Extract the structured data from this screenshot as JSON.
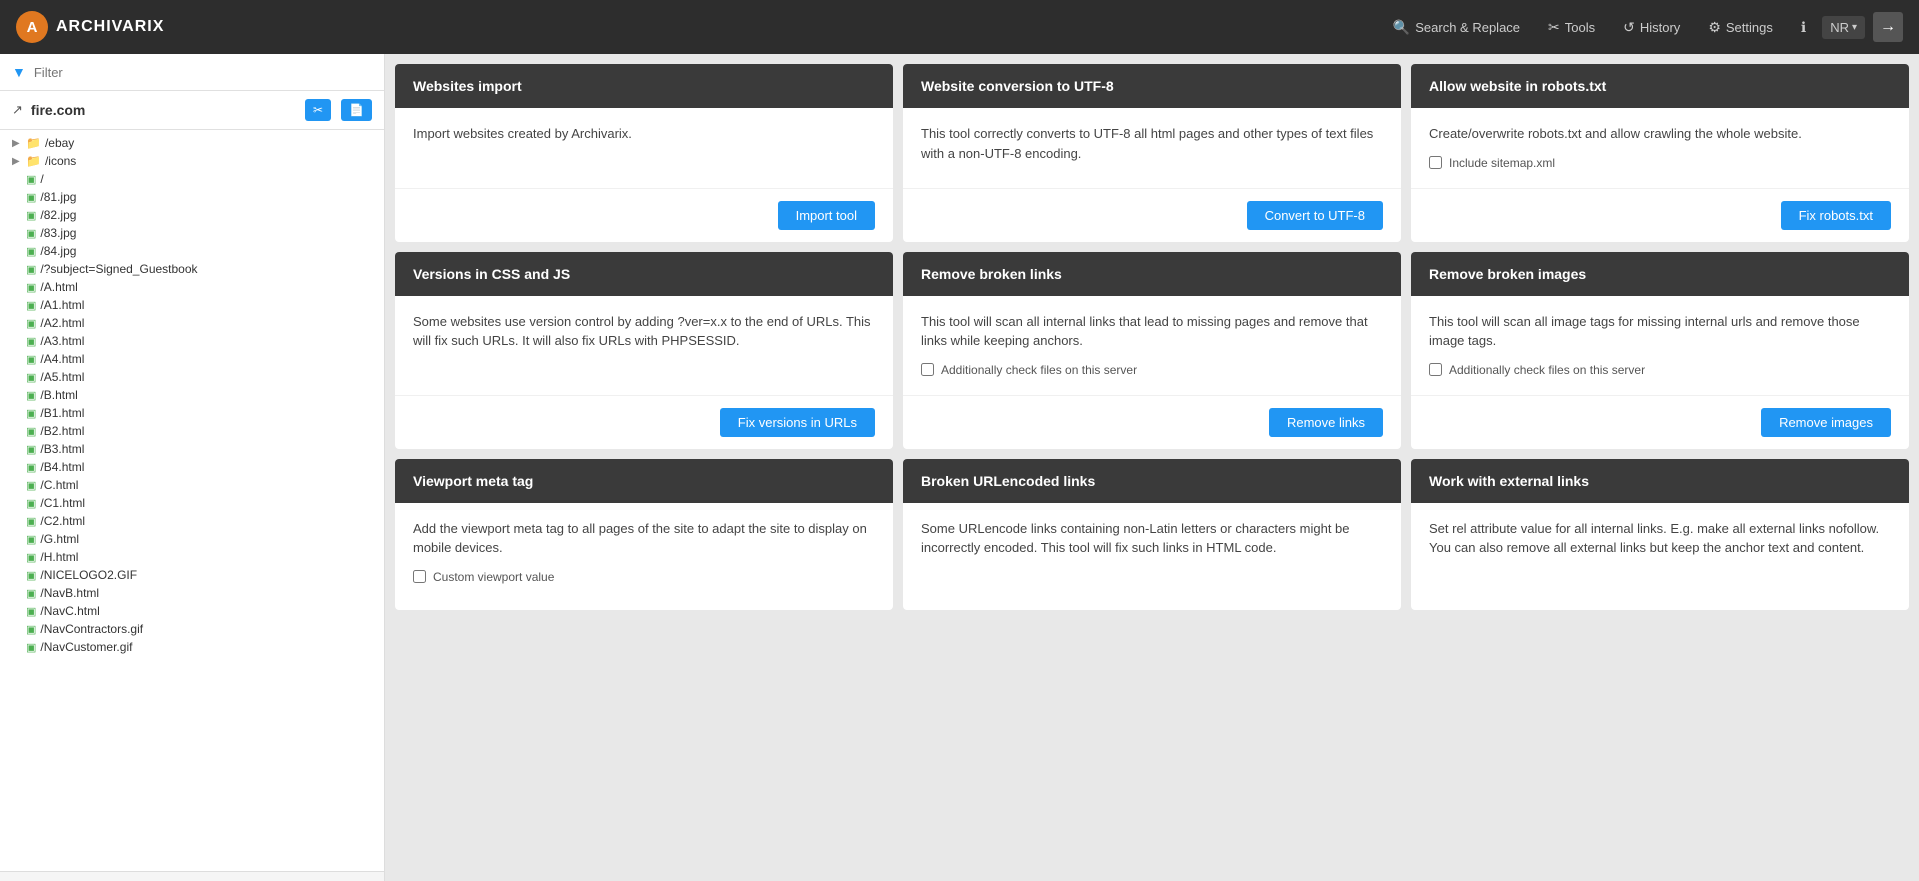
{
  "topnav": {
    "logo_letter": "A",
    "logo_text": "ARCHIVARIX",
    "nav_items": [
      {
        "id": "search-replace",
        "icon": "🔍",
        "label": "Search & Replace"
      },
      {
        "id": "tools",
        "icon": "✂",
        "label": "Tools"
      },
      {
        "id": "history",
        "icon": "↺",
        "label": "History"
      },
      {
        "id": "settings",
        "icon": "⚙",
        "label": "Settings"
      },
      {
        "id": "info",
        "icon": "ℹ",
        "label": ""
      }
    ],
    "dropdown_label": "NR",
    "exit_icon": "→"
  },
  "sidebar": {
    "filter_placeholder": "Filter",
    "site_name": "fire.com",
    "btn1_label": "✂",
    "btn2_label": "📄",
    "files": [
      {
        "type": "folder",
        "name": "/ebay",
        "expanded": false
      },
      {
        "type": "folder",
        "name": "/icons",
        "expanded": false
      },
      {
        "type": "page",
        "name": "/"
      },
      {
        "type": "page",
        "name": "/81.jpg"
      },
      {
        "type": "page",
        "name": "/82.jpg"
      },
      {
        "type": "page",
        "name": "/83.jpg"
      },
      {
        "type": "page",
        "name": "/84.jpg"
      },
      {
        "type": "page",
        "name": "/?subject=Signed_Guestbook"
      },
      {
        "type": "page",
        "name": "/A.html"
      },
      {
        "type": "page",
        "name": "/A1.html"
      },
      {
        "type": "page",
        "name": "/A2.html"
      },
      {
        "type": "page",
        "name": "/A3.html"
      },
      {
        "type": "page",
        "name": "/A4.html"
      },
      {
        "type": "page",
        "name": "/A5.html"
      },
      {
        "type": "page",
        "name": "/B.html"
      },
      {
        "type": "page",
        "name": "/B1.html"
      },
      {
        "type": "page",
        "name": "/B2.html"
      },
      {
        "type": "page",
        "name": "/B3.html"
      },
      {
        "type": "page",
        "name": "/B4.html"
      },
      {
        "type": "page",
        "name": "/C.html"
      },
      {
        "type": "page",
        "name": "/C1.html"
      },
      {
        "type": "page",
        "name": "/C2.html"
      },
      {
        "type": "page",
        "name": "/G.html"
      },
      {
        "type": "page",
        "name": "/H.html"
      },
      {
        "type": "page",
        "name": "/NICELOGO2.GIF"
      },
      {
        "type": "page",
        "name": "/NavB.html"
      },
      {
        "type": "page",
        "name": "/NavC.html"
      },
      {
        "type": "page",
        "name": "/NavContractors.gif"
      },
      {
        "type": "page",
        "name": "/NavCustomer.gif"
      }
    ]
  },
  "cards": [
    {
      "id": "websites-import",
      "header": "Websites import",
      "body": "Import websites created by Archivarix.",
      "checkboxes": [],
      "button": "Import tool"
    },
    {
      "id": "website-conversion-utf8",
      "header": "Website conversion to UTF-8",
      "body": "This tool correctly converts to UTF-8 all html pages and other types of text files with a non-UTF-8 encoding.",
      "checkboxes": [],
      "button": "Convert to UTF-8"
    },
    {
      "id": "allow-robots",
      "header": "Allow website in robots.txt",
      "body": "Create/overwrite robots.txt and allow crawling the whole website.",
      "checkboxes": [
        {
          "id": "include-sitemap",
          "label": "Include sitemap.xml"
        }
      ],
      "button": "Fix robots.txt"
    },
    {
      "id": "versions-css-js",
      "header": "Versions in CSS and JS",
      "body": "Some websites use version control by adding ?ver=x.x to the end of URLs. This will fix such URLs. It will also fix URLs with PHPSESSID.",
      "checkboxes": [],
      "button": "Fix versions in URLs"
    },
    {
      "id": "remove-broken-links",
      "header": "Remove broken links",
      "body": "This tool will scan all internal links that lead to missing pages and remove that links while keeping anchors.",
      "checkboxes": [
        {
          "id": "check-files-links",
          "label": "Additionally check files on this server"
        }
      ],
      "button": "Remove links"
    },
    {
      "id": "remove-broken-images",
      "header": "Remove broken images",
      "body": "This tool will scan all image tags for missing internal urls and remove those image tags.",
      "checkboxes": [
        {
          "id": "check-files-images",
          "label": "Additionally check files on this server"
        }
      ],
      "button": "Remove images"
    },
    {
      "id": "viewport-meta-tag",
      "header": "Viewport meta tag",
      "body": "Add the viewport meta tag to all pages of the site to adapt the site to display on mobile devices.",
      "checkboxes": [
        {
          "id": "custom-viewport",
          "label": "Custom viewport value"
        }
      ],
      "button": null
    },
    {
      "id": "broken-urlencoded-links",
      "header": "Broken URLencoded links",
      "body": "Some URLencode links containing non-Latin letters or characters might be incorrectly encoded. This tool will fix such links in HTML code.",
      "checkboxes": [],
      "button": null
    },
    {
      "id": "work-external-links",
      "header": "Work with external links",
      "body": "Set rel attribute value for all internal links. E.g. make all external links nofollow.\nYou can also remove all external links but keep the anchor text and content.",
      "checkboxes": [],
      "button": null
    }
  ]
}
